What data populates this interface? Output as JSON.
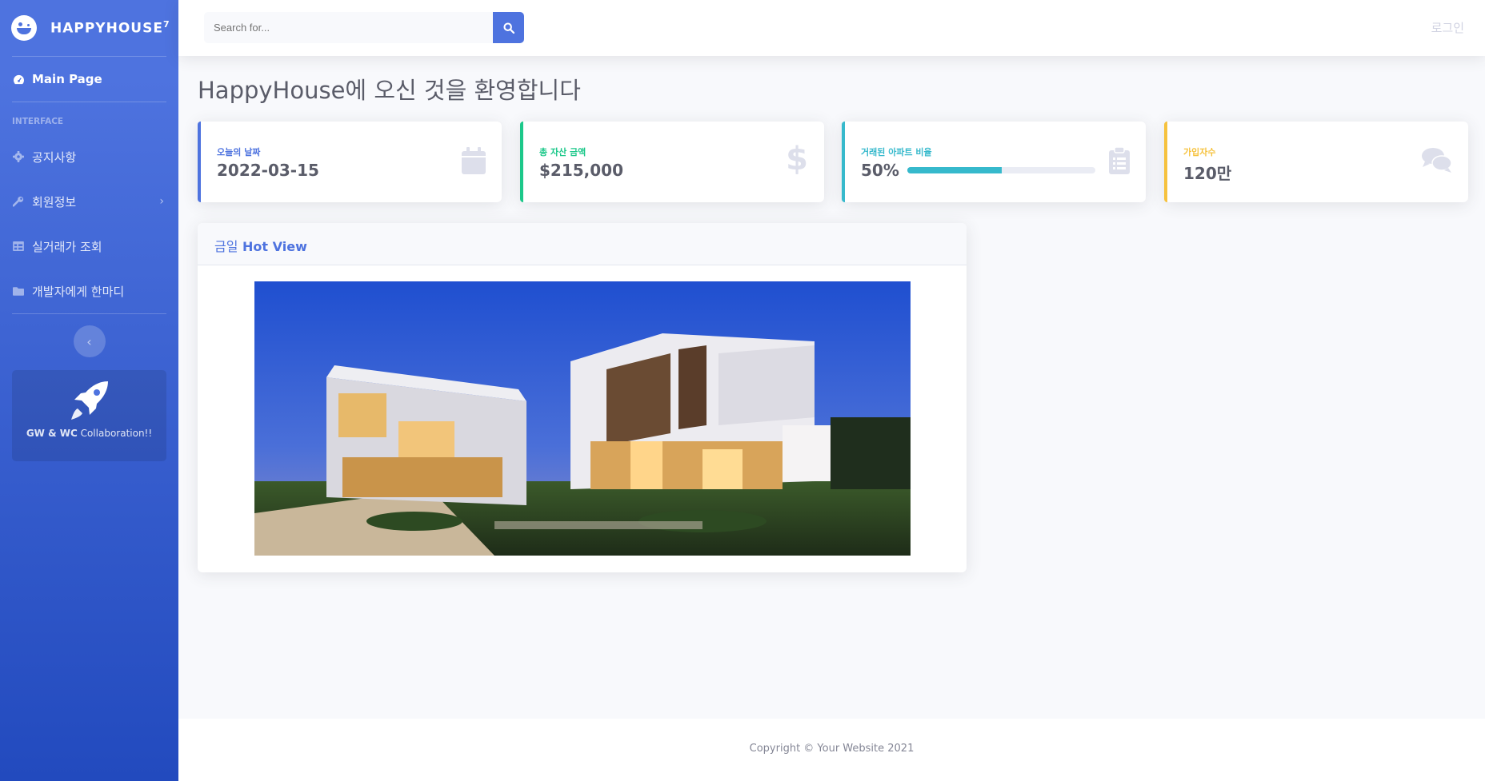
{
  "sidebar": {
    "brand": "HAPPYHOUSE",
    "brand_sup": "7",
    "main_page": "Main Page",
    "heading": "INTERFACE",
    "items": [
      {
        "label": "공지사항",
        "icon": "gear-icon"
      },
      {
        "label": "회원정보",
        "icon": "wrench-icon",
        "has_arrow": true
      },
      {
        "label": "실거래가 조회",
        "icon": "table-icon"
      },
      {
        "label": "개발자에게 한마디",
        "icon": "folder-icon"
      }
    ],
    "promo_bold": "GW & WC",
    "promo_text": " Collaboration!!"
  },
  "topbar": {
    "search_placeholder": "Search for...",
    "login": "로그인"
  },
  "page_title": "HappyHouse에 오신 것을 환영합니다",
  "stats": [
    {
      "label": "오늘의 날짜",
      "value": "2022-03-15",
      "color": "#4e73df",
      "icon": "calendar-icon"
    },
    {
      "label": "총 자산 금액",
      "value": "$215,000",
      "color": "#1cc88a",
      "icon": "dollar-icon"
    },
    {
      "label": "거래된 아파트 비율",
      "value": "50%",
      "color": "#36b9cc",
      "icon": "clipboard-icon",
      "progress": 50
    },
    {
      "label": "가입자수",
      "value": "120만",
      "color": "#f6c23e",
      "icon": "comments-icon"
    }
  ],
  "hot_view": {
    "title_ko": "금일",
    "title_en": " Hot View"
  },
  "footer": "Copyright © Your Website 2021"
}
